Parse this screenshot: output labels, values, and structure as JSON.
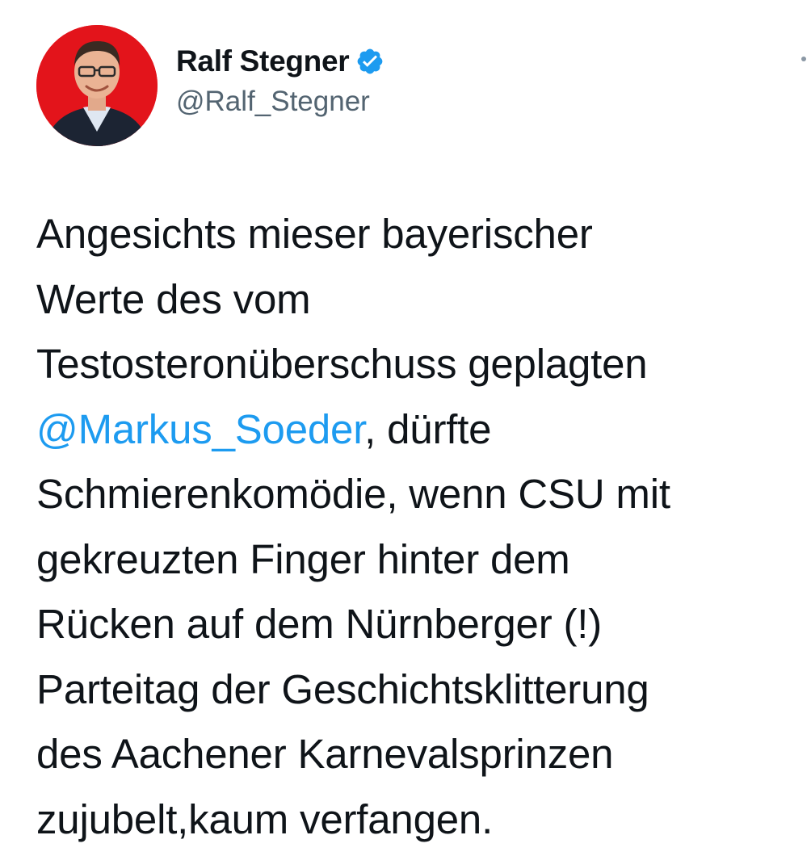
{
  "author": {
    "display_name": "Ralf Stegner",
    "handle": "@Ralf_Stegner",
    "verified_icon": "verified-badge-icon",
    "avatar": "profile-photo-avatar"
  },
  "more_icon": "more-options-icon",
  "tweet": {
    "line1": "Angesichts mieser bayerischer",
    "line2": "Werte des vom",
    "line3": "Testosteronüberschuss geplagten",
    "line4_mention": "@Markus_Soeder",
    "line4_rest": ", dürfte",
    "line5": "Schmierenkomödie, wenn CSU mit",
    "line6": "gekreuzten Finger hinter dem",
    "line7": "Rücken auf dem Nürnberger (!)",
    "line8": "Parteitag der Geschichtsklitterung",
    "line9": "des Aachener Karnevalsprinzen",
    "line10": "zujubelt,kaum verfangen."
  },
  "colors": {
    "mention": "#1d9bf0",
    "verified": "#1d9bf0",
    "avatar_background": "#e3141b",
    "handle": "#536471",
    "text": "#0f1419"
  }
}
